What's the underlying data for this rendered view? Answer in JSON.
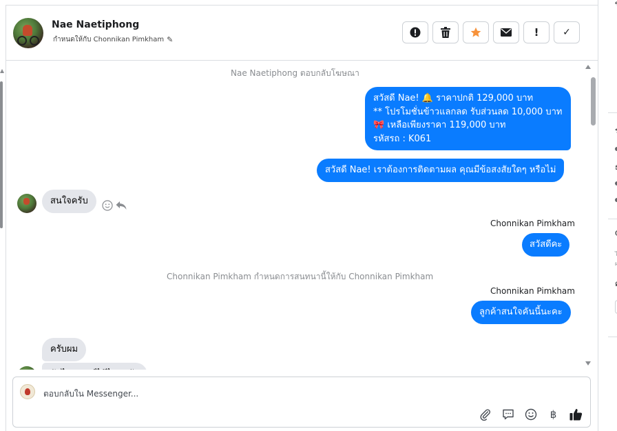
{
  "header": {
    "name": "Nae Naetiphong",
    "assigned_text": "กำหนดให้กับ Chonnikan Pimkham",
    "pencil": "✎",
    "actions": [
      {
        "name": "alert-circle-icon"
      },
      {
        "name": "trash-icon"
      },
      {
        "name": "star-icon",
        "color": "#f7923a"
      },
      {
        "name": "envelope-icon"
      },
      {
        "name": "exclamation-icon",
        "glyph": "!"
      },
      {
        "name": "checkmark-icon",
        "glyph": "✓"
      }
    ]
  },
  "thread": {
    "system_1": "Nae Naetiphong ตอบกลับโฆษณา",
    "out_1": {
      "line1": "สวัสดี Nae! 🔔 ราคาปกติ 129,000 บาท",
      "line2": "** โปรโมชั่นข้าวแลกลด รับส่วนลด 10,000 บาท",
      "line3": "🎀  เหลือเพียงราคา 119,000 บาท",
      "line4": " รหัสรถ : K061"
    },
    "out_2": "สวัสดี Nae! เราต้องการติดตามผล คุณมีข้อสงสัยใดๆ หรือไม่",
    "in_1": "สนใจครับ",
    "sender_1": "Chonnikan Pimkham",
    "out_3": "สวัสดีคะ",
    "system_2": "Chonnikan Pimkham กำหนดการสนทนานี้ให้กับ Chonnikan Pimkham",
    "sender_2": "Chonnikan Pimkham",
    "out_4": "ลูกค้าสนใจคันนี้นะคะ",
    "in_2": "ครับผม",
    "in_3": "จัดไฟแนนซ์ได้ไหมครับ"
  },
  "composer": {
    "placeholder": "ตอบกลับใน Messenger...",
    "tools": [
      "paperclip-icon",
      "speech-bubble-icon",
      "emoji-icon",
      "baht-icon",
      "thumbs-up-icon"
    ],
    "baht_glyph": "฿"
  },
  "right_panel": {
    "chars": [
      "ข",
      "ร",
      "ธ",
      "ถ",
      "ผ",
      "ด"
    ],
    "small": [
      "ไ",
      "ฝ"
    ],
    "letter_g": "ค",
    "letter_a": "C"
  },
  "colors": {
    "accent": "#0a7cff",
    "incoming": "#e4e6eb",
    "system_text": "#8a8d91"
  }
}
